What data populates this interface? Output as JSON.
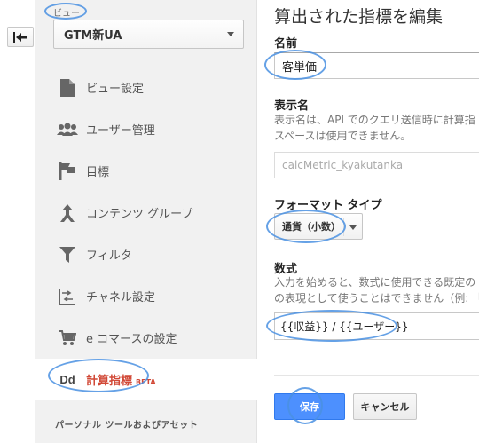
{
  "sidebar": {
    "view_label": "ビュー",
    "view_select": "GTM新UA",
    "items": [
      {
        "label": "ビュー設定",
        "icon": "document-icon"
      },
      {
        "label": "ユーザー管理",
        "icon": "users-icon"
      },
      {
        "label": "目標",
        "icon": "flag-icon"
      },
      {
        "label": "コンテンツ グループ",
        "icon": "content-group-icon"
      },
      {
        "label": "フィルタ",
        "icon": "filter-icon"
      },
      {
        "label": "チャネル設定",
        "icon": "channel-icon"
      },
      {
        "label": "e コマースの設定",
        "icon": "cart-icon"
      },
      {
        "label": "計算指標",
        "icon": "dd-icon",
        "badge": "BETA",
        "active": true
      }
    ],
    "section_label": "パーソナル ツールおよびアセット"
  },
  "main": {
    "title": "算出された指標を編集",
    "name_label": "名前",
    "name_value": "客単価",
    "display_label": "表示名",
    "display_desc": [
      "表示名は、API でのクエリ送信時に計算指",
      "スペースは使用できません。"
    ],
    "display_value": "calcMetric_kyakutanka",
    "format_label": "フォーマット タイプ",
    "format_value": "通貨（小数）",
    "formula_label": "数式",
    "formula_desc": [
      "入力を始めると、数式に使用できる既定の",
      "の表現として使うことはできません（例: 「A"
    ],
    "formula_value": "{{収益}} / {{ユーザー}}",
    "save_label": "保存",
    "cancel_label": "キャンセル"
  },
  "colors": {
    "accent": "#4d90fe",
    "active": "#d14836",
    "annotation": "#4a90e2"
  }
}
